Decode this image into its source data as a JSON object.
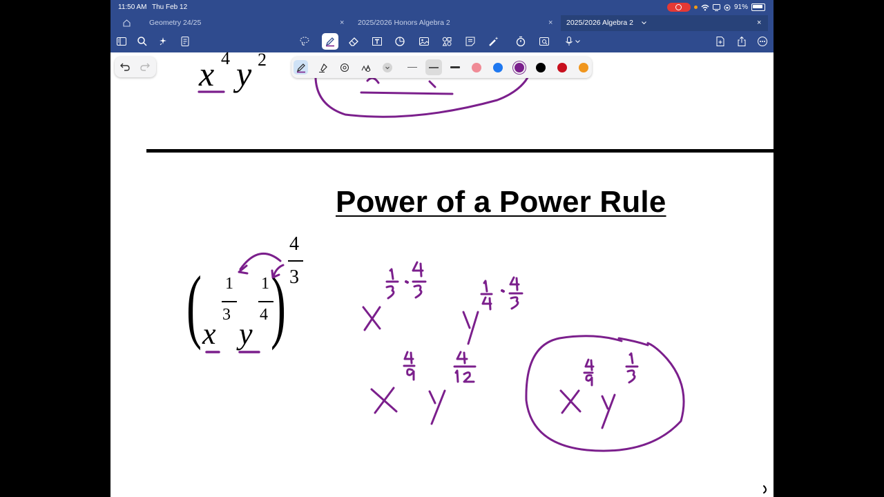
{
  "status_bar": {
    "time": "11:50 AM",
    "date": "Thu Feb 12",
    "battery": "91%"
  },
  "tabs": [
    {
      "label": "Geometry 24/25"
    },
    {
      "label": "2025/2026 Honors Algebra 2"
    },
    {
      "label": "2025/2026 Algebra 2",
      "active": true
    }
  ],
  "toolbar_icons": [
    "sidebar-icon",
    "search-icon",
    "sparkle-icon",
    "document-icon",
    "lasso-icon",
    "pen-icon",
    "eraser-icon",
    "text-box-icon",
    "shapes-icon",
    "image-icon",
    "elements-icon",
    "sticky-note-icon",
    "laser-pointer-icon",
    "timer-icon",
    "zoom-window-icon",
    "microphone-icon",
    "add-page-icon",
    "share-icon",
    "more-icon"
  ],
  "pen_colors": [
    "#f08b96",
    "#1f78f0",
    "#7b1f8c",
    "#000000",
    "#c8101e",
    "#f0961e"
  ],
  "ink_color": "#7b1f8c",
  "page": {
    "title": "Power of a Power Rule",
    "top_expression": {
      "x": "x",
      "x_exp": "4",
      "y": "y",
      "y_exp": "2"
    },
    "problem": {
      "outer_exp_num": "4",
      "outer_exp_den": "3",
      "x": "x",
      "x_exp_num": "1",
      "x_exp_den": "3",
      "y": "y",
      "y_exp_num": "1",
      "y_exp_den": "4"
    }
  }
}
